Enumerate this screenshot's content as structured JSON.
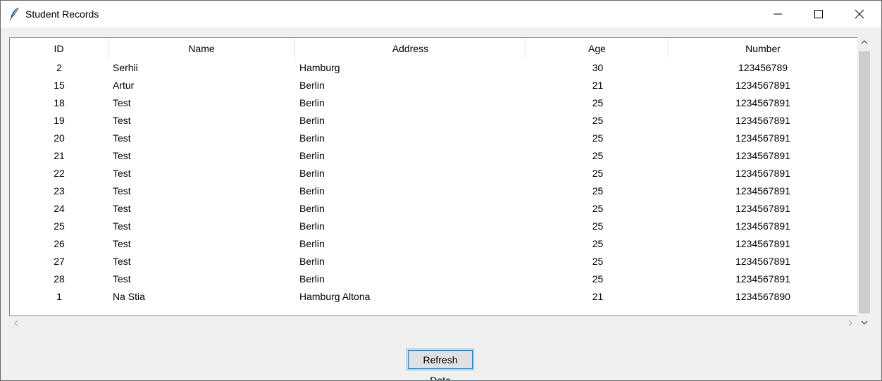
{
  "window": {
    "title": "Student Records",
    "icon": "feather-icon"
  },
  "table": {
    "columns": [
      "ID",
      "Name",
      "Address",
      "Age",
      "Number"
    ],
    "rows": [
      [
        "2",
        "Serhii",
        "Hamburg",
        "30",
        "123456789"
      ],
      [
        "15",
        "Artur",
        "Berlin",
        "21",
        "1234567891"
      ],
      [
        "18",
        "Test",
        "Berlin",
        "25",
        "1234567891"
      ],
      [
        "19",
        "Test",
        "Berlin",
        "25",
        "1234567891"
      ],
      [
        "20",
        "Test",
        "Berlin",
        "25",
        "1234567891"
      ],
      [
        "21",
        "Test",
        "Berlin",
        "25",
        "1234567891"
      ],
      [
        "22",
        "Test",
        "Berlin",
        "25",
        "1234567891"
      ],
      [
        "23",
        "Test",
        "Berlin",
        "25",
        "1234567891"
      ],
      [
        "24",
        "Test",
        "Berlin",
        "25",
        "1234567891"
      ],
      [
        "25",
        "Test",
        "Berlin",
        "25",
        "1234567891"
      ],
      [
        "26",
        "Test",
        "Berlin",
        "25",
        "1234567891"
      ],
      [
        "27",
        "Test",
        "Berlin",
        "25",
        "1234567891"
      ],
      [
        "28",
        "Test",
        "Berlin",
        "25",
        "1234567891"
      ],
      [
        "1",
        "Na Stia",
        "Hamburg Altona",
        "21",
        "1234567890"
      ]
    ]
  },
  "buttons": {
    "refresh_label": "Refresh Data"
  },
  "colors": {
    "focus_accent": "#0078d7",
    "scroll_thumb": "#cdcdcd"
  }
}
